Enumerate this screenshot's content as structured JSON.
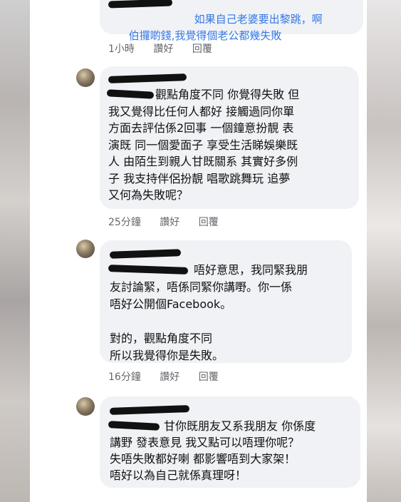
{
  "comments": [
    {
      "text_line1": "如果自己老婆要出黎跳，啊",
      "text_line2": "伯攞啲錢,我覺得個老公都幾失敗",
      "time": "1小時",
      "like": "讚好",
      "reply": "回覆"
    },
    {
      "text": "觀點角度不同 你覺得失敗 但\n我又覺得比任何人都好 接觸過同你單\n方面去評估係2回事 一個鐘意扮靚 表\n演既 同一個愛面子 享受生活睇娛樂既\n人 由陌生到親人甘既關系 其實好多例\n子 我支持伴侶扮靚 唱歌跳舞玩 追夢\n又何為失敗呢？",
      "time": "25分鐘",
      "like": "讚好",
      "reply": "回覆"
    },
    {
      "text_first": "唔好意思，我同緊我朋",
      "text": "友討論緊，唔係同緊你講嘢。你一係\n唔好公開個Facebook。\n\n對的，觀點角度不同\n所以我覺得你是失敗。",
      "time": "16分鐘",
      "like": "讚好",
      "reply": "回覆"
    },
    {
      "text_first": "甘你既朋友又系我朋友 你係度",
      "text": "講野 發表意見 我又點可以唔理你呢？\n失唔失敗都好喇 都影響唔到大家架！\n唔好以為自己就係真理呀！"
    }
  ]
}
